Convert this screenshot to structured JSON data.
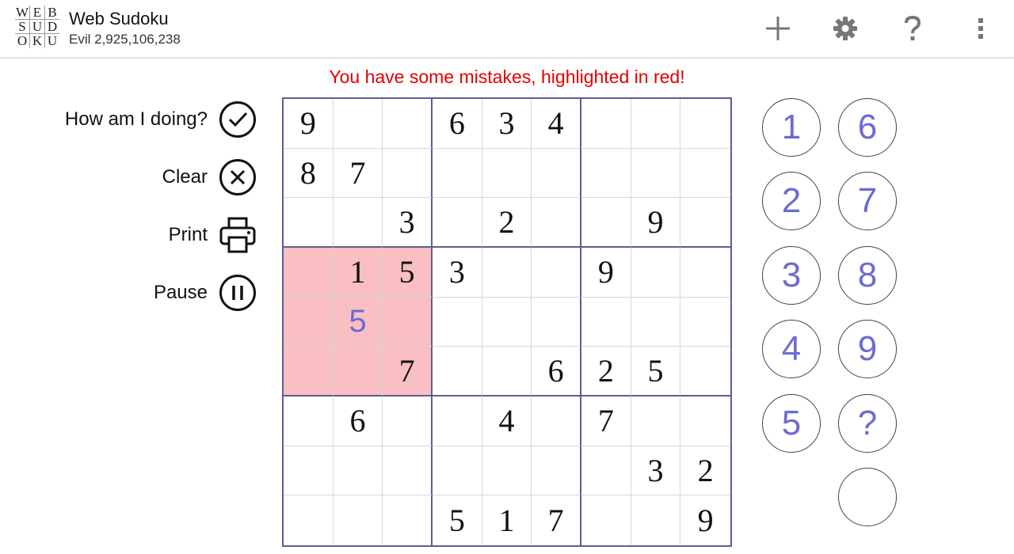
{
  "header": {
    "logo_rows": [
      [
        "W",
        "E",
        "B"
      ],
      [
        "S",
        "U",
        "D"
      ],
      [
        "O",
        "K",
        "U"
      ]
    ],
    "title": "Web Sudoku",
    "subtitle": "Evil 2,925,106,238",
    "actions": [
      {
        "name": "new-game-button",
        "icon": "plus-icon"
      },
      {
        "name": "settings-button",
        "icon": "gear-icon"
      },
      {
        "name": "help-button",
        "icon": "question-icon"
      },
      {
        "name": "overflow-menu-button",
        "icon": "kebab-menu-icon"
      }
    ]
  },
  "banner": "You have some mistakes, highlighted in red!",
  "sidebar": {
    "how_label": "How am I doing?",
    "clear_label": "Clear",
    "print_label": "Print",
    "pause_label": "Pause"
  },
  "board": {
    "rows": [
      [
        "9",
        "",
        "",
        "6",
        "3",
        "4",
        "",
        "",
        ""
      ],
      [
        "8",
        "7",
        "",
        "",
        "",
        "",
        "",
        "",
        ""
      ],
      [
        "",
        "",
        "3",
        "",
        "2",
        "",
        "",
        "9",
        ""
      ],
      [
        "",
        "1",
        "5",
        "3",
        "",
        "",
        "9",
        "",
        ""
      ],
      [
        "",
        "5",
        "",
        "",
        "",
        "",
        "",
        "",
        ""
      ],
      [
        "",
        "",
        "7",
        "",
        "",
        "6",
        "2",
        "5",
        ""
      ],
      [
        "",
        "6",
        "",
        "",
        "4",
        "",
        "7",
        "",
        ""
      ],
      [
        "",
        "",
        "",
        "",
        "",
        "",
        "",
        "3",
        "2"
      ],
      [
        "",
        "",
        "",
        "5",
        "1",
        "7",
        "",
        "",
        "9"
      ]
    ],
    "error_cells": [
      [
        3,
        0
      ],
      [
        3,
        1
      ],
      [
        3,
        2
      ],
      [
        4,
        0
      ],
      [
        4,
        1
      ],
      [
        4,
        2
      ],
      [
        5,
        0
      ],
      [
        5,
        1
      ],
      [
        5,
        2
      ]
    ],
    "user_cells": [
      [
        4,
        1
      ]
    ],
    "colors": {
      "grid_major": "#5e5d8f",
      "grid_minor": "#d6d6dc",
      "error_bg": "#f9bfc2",
      "user_digit": "#6b6bd4"
    }
  },
  "numpad": {
    "left": [
      "1",
      "2",
      "3",
      "4",
      "5"
    ],
    "right": [
      "6",
      "7",
      "8",
      "9",
      "?",
      ""
    ]
  }
}
